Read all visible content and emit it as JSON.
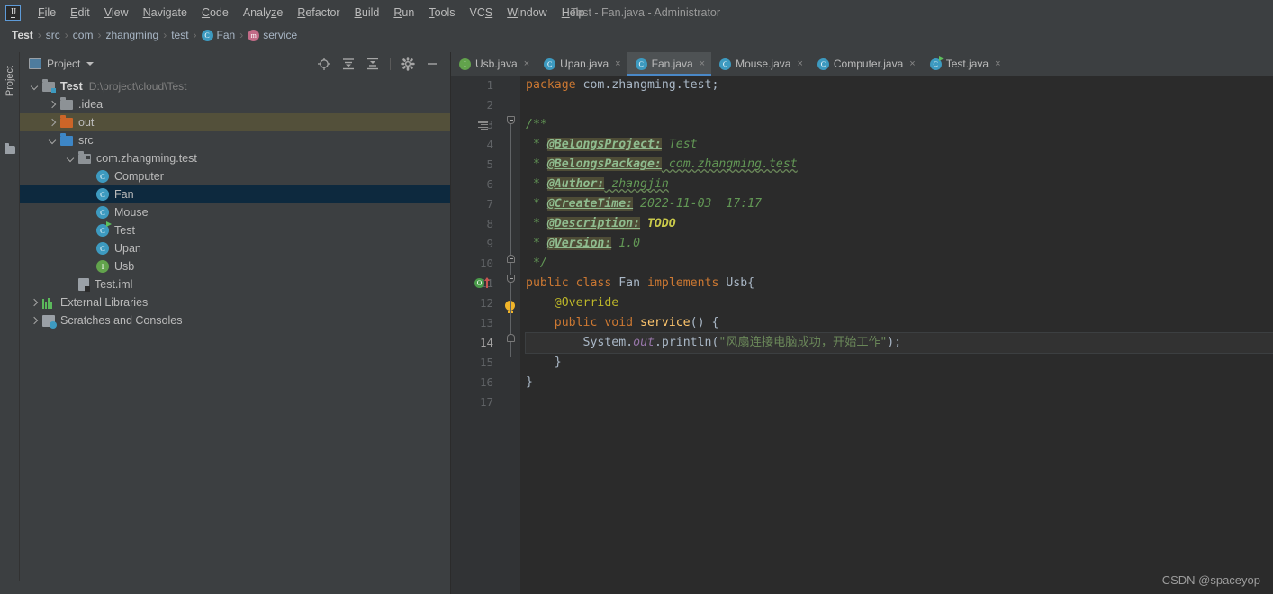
{
  "titlebar": {
    "logo": "IJ",
    "window_title": "Test - Fan.java - Administrator",
    "menus": [
      {
        "label": "File",
        "mnemonic": "F"
      },
      {
        "label": "Edit",
        "mnemonic": "E"
      },
      {
        "label": "View",
        "mnemonic": "V"
      },
      {
        "label": "Navigate",
        "mnemonic": "N"
      },
      {
        "label": "Code",
        "mnemonic": "C"
      },
      {
        "label": "Analyze",
        "mnemonic": "z"
      },
      {
        "label": "Refactor",
        "mnemonic": "R"
      },
      {
        "label": "Build",
        "mnemonic": "B"
      },
      {
        "label": "Run",
        "mnemonic": "R"
      },
      {
        "label": "Tools",
        "mnemonic": "T"
      },
      {
        "label": "VCS",
        "mnemonic": "S"
      },
      {
        "label": "Window",
        "mnemonic": "W"
      },
      {
        "label": "Help",
        "mnemonic": "H"
      }
    ]
  },
  "breadcrumb": {
    "separator": "›",
    "items": [
      {
        "label": "Test",
        "icon": "none"
      },
      {
        "label": "src",
        "icon": "none"
      },
      {
        "label": "com",
        "icon": "none"
      },
      {
        "label": "zhangming",
        "icon": "none"
      },
      {
        "label": "test",
        "icon": "none"
      },
      {
        "label": "Fan",
        "icon": "class-icon",
        "icon_letter": "C"
      },
      {
        "label": "service",
        "icon": "method-icon",
        "icon_letter": "m"
      }
    ]
  },
  "rail": {
    "project_tab_label": "Project",
    "folder_icon": "folder-icon"
  },
  "project_panel": {
    "header": {
      "title": "Project",
      "view_icon": "project-view-icon",
      "dropdown_icon": "chevron-down-icon",
      "actions": [
        {
          "name": "locate-icon",
          "title": "Select Opened File"
        },
        {
          "name": "expand-all-icon",
          "title": "Expand All"
        },
        {
          "name": "collapse-all-icon",
          "title": "Collapse All"
        },
        {
          "name": "gear-icon",
          "title": "Settings"
        },
        {
          "name": "minimize-icon",
          "title": "Hide"
        }
      ]
    },
    "tree": [
      {
        "label": "Test",
        "secondary": "D:\\project\\cloud\\Test",
        "indent": 0,
        "arrow": "down",
        "icon": "module-folder-icon",
        "bold": true,
        "state": "normal"
      },
      {
        "label": ".idea",
        "secondary": "",
        "indent": 1,
        "arrow": "right",
        "icon": "folder-icon",
        "bold": false,
        "state": "normal"
      },
      {
        "label": "out",
        "secondary": "",
        "indent": 1,
        "arrow": "right",
        "icon": "folder-orange-icon",
        "bold": false,
        "state": "excluded"
      },
      {
        "label": "src",
        "secondary": "",
        "indent": 1,
        "arrow": "down",
        "icon": "folder-source-icon",
        "bold": false,
        "state": "normal"
      },
      {
        "label": "com.zhangming.test",
        "secondary": "",
        "indent": 2,
        "arrow": "down",
        "icon": "package-icon",
        "bold": false,
        "state": "normal"
      },
      {
        "label": "Computer",
        "secondary": "",
        "indent": 3,
        "arrow": "none",
        "icon": "class-icon",
        "bold": false,
        "state": "normal"
      },
      {
        "label": "Fan",
        "secondary": "",
        "indent": 3,
        "arrow": "none",
        "icon": "class-icon",
        "bold": false,
        "state": "selected"
      },
      {
        "label": "Mouse",
        "secondary": "",
        "indent": 3,
        "arrow": "none",
        "icon": "class-icon",
        "bold": false,
        "state": "normal"
      },
      {
        "label": "Test",
        "secondary": "",
        "indent": 3,
        "arrow": "none",
        "icon": "runnable-class-icon",
        "bold": false,
        "state": "normal"
      },
      {
        "label": "Upan",
        "secondary": "",
        "indent": 3,
        "arrow": "none",
        "icon": "class-icon",
        "bold": false,
        "state": "normal"
      },
      {
        "label": "Usb",
        "secondary": "",
        "indent": 3,
        "arrow": "none",
        "icon": "interface-icon",
        "bold": false,
        "state": "normal"
      },
      {
        "label": "Test.iml",
        "secondary": "",
        "indent": 2,
        "arrow": "none",
        "icon": "iml-file-icon",
        "bold": false,
        "state": "normal"
      },
      {
        "label": "External Libraries",
        "secondary": "",
        "indent": 0,
        "arrow": "right",
        "icon": "libraries-icon",
        "bold": false,
        "state": "normal"
      },
      {
        "label": "Scratches and Consoles",
        "secondary": "",
        "indent": 0,
        "arrow": "right",
        "icon": "scratches-icon",
        "bold": false,
        "state": "normal"
      }
    ]
  },
  "editor": {
    "tabs": [
      {
        "label": "Usb.java",
        "icon": "interface-icon",
        "icon_letter": "I",
        "active": false,
        "close": "×"
      },
      {
        "label": "Upan.java",
        "icon": "class-icon",
        "icon_letter": "C",
        "active": false,
        "close": "×"
      },
      {
        "label": "Fan.java",
        "icon": "class-icon",
        "icon_letter": "C",
        "active": true,
        "close": "×"
      },
      {
        "label": "Mouse.java",
        "icon": "class-icon",
        "icon_letter": "C",
        "active": false,
        "close": "×"
      },
      {
        "label": "Computer.java",
        "icon": "class-icon",
        "icon_letter": "C",
        "active": false,
        "close": "×"
      },
      {
        "label": "Test.java",
        "icon": "runnable-class-icon",
        "icon_letter": "C",
        "active": false,
        "close": "×"
      }
    ],
    "line_numbers": [
      "1",
      "2",
      "3",
      "4",
      "5",
      "6",
      "7",
      "8",
      "9",
      "10",
      "11",
      "12",
      "13",
      "14",
      "15",
      "16",
      "17"
    ],
    "current_line": 14,
    "gutter_icons": [
      {
        "line": 3,
        "name": "javadoc-icon"
      },
      {
        "line": 13,
        "name": "implementing-method-icon"
      },
      {
        "line": 14,
        "name": "intention-bulb-icon"
      }
    ],
    "code_lines": [
      {
        "n": 1,
        "text": "package com.zhangming.test;"
      },
      {
        "n": 2,
        "text": ""
      },
      {
        "n": 3,
        "text": "/**"
      },
      {
        "n": 4,
        "text": " * @BelongsProject: Test"
      },
      {
        "n": 5,
        "text": " * @BelongsPackage: com.zhangming.test"
      },
      {
        "n": 6,
        "text": " * @Author: zhangjin"
      },
      {
        "n": 7,
        "text": " * @CreateTime: 2022-11-03  17:17"
      },
      {
        "n": 8,
        "text": " * @Description: TODO"
      },
      {
        "n": 9,
        "text": " * @Version: 1.0"
      },
      {
        "n": 10,
        "text": " */"
      },
      {
        "n": 11,
        "text": "public class Fan implements Usb{"
      },
      {
        "n": 12,
        "text": "    @Override"
      },
      {
        "n": 13,
        "text": "    public void service() {"
      },
      {
        "n": 14,
        "text": "        System.out.println(\"风扇连接电脑成功，开始工作\");"
      },
      {
        "n": 15,
        "text": "    }"
      },
      {
        "n": 16,
        "text": "}"
      },
      {
        "n": 17,
        "text": ""
      }
    ],
    "tokens": {
      "kw_package": "package",
      "pkg_name": "com.zhangming.test",
      "semi": ";",
      "doc_open": "/**",
      "doc_close": " */",
      "star": " * ",
      "tag_project": "@BelongsProject:",
      "val_project": " Test",
      "tag_package": "@BelongsPackage:",
      "val_package": " com.zhangming.test",
      "tag_author": "@Author:",
      "val_author": " zhangjin",
      "tag_createtime": "@CreateTime:",
      "val_createtime": " 2022-11-03  17:17",
      "tag_description": "@Description:",
      "val_description": " TODO",
      "tag_version": "@Version:",
      "val_version": " 1.0",
      "kw_public": "public",
      "kw_class": "class",
      "class_name": " Fan ",
      "kw_implements": "implements",
      "iface_name": " Usb{",
      "annotation_override": "    @Override",
      "kw_public2": "    public",
      "kw_void": " void",
      "method_name": " service",
      "method_tail": "() {",
      "indent_println": "        ",
      "sys": "System",
      "dot": ".",
      "out": "out",
      "println": ".println(",
      "quote": "\"",
      "chinese": "风扇连接电脑成功，开始工作",
      "tail": ");",
      "brace_close_inner": "    }",
      "brace_close_outer": "}"
    }
  },
  "watermark": {
    "text": "CSDN @spaceyop"
  },
  "colors": {
    "chrome": "#3c3f41",
    "editor_bg": "#2b2b2b",
    "gutter_bg": "#313335",
    "accent": "#4a88c7",
    "selection": "#0d293e",
    "excluded": "#53503a",
    "keyword": "#cc7832",
    "string": "#6a8759",
    "comment": "#629755",
    "number": "#6897bb",
    "field": "#9876aa",
    "method": "#ffc66d",
    "annotation": "#bbb529",
    "todo": "#c9c94a"
  }
}
